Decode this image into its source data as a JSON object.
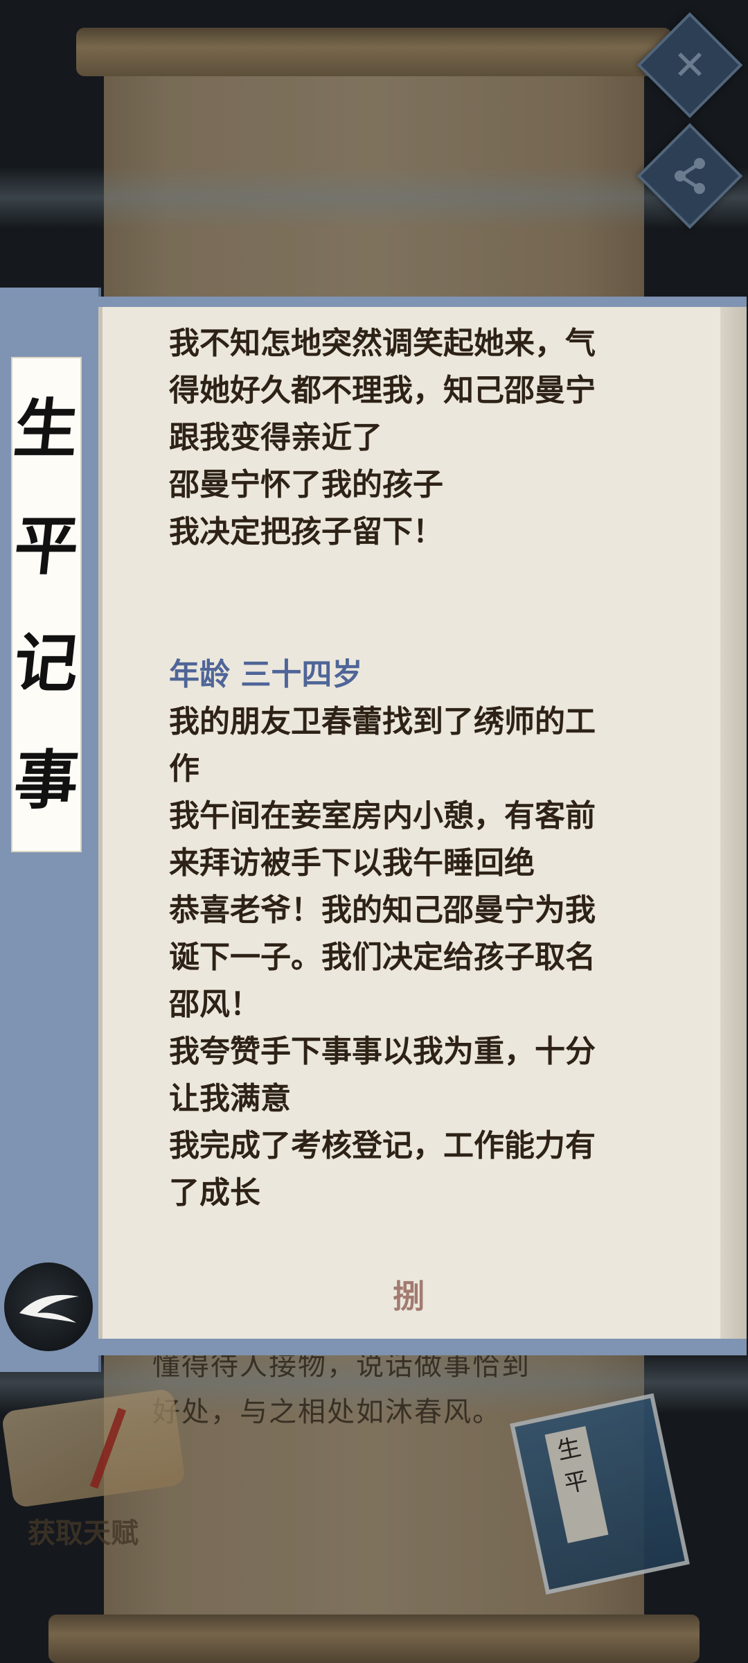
{
  "modal": {
    "title_chars": [
      "生",
      "平",
      "记",
      "事"
    ],
    "lines_before": [
      "我不知怎地突然调笑起她来，气",
      "得她好久都不理我，知己邵曼宁",
      "跟我变得亲近了",
      "邵曼宁怀了我的孩子",
      "我决定把孩子留下！"
    ],
    "age_heading": "年龄 三十四岁",
    "lines_after": [
      "我的朋友卫春蕾找到了绣师的工",
      "作",
      "我午间在妾室房内小憩，有客前",
      "来拜访被手下以我午睡回绝",
      "恭喜老爷！我的知己邵曼宁为我",
      "诞下一子。我们决定给孩子取名",
      "邵风！",
      "我夸赞手下事事以我为重，十分",
      "让我满意",
      "我完成了考核登记，工作能力有",
      "了成长"
    ],
    "end_mark": "捌"
  },
  "background": {
    "desc_line1": "懂得待人接物，说话做事恰到",
    "desc_line2": "好处，与之相处如沐春风。",
    "talent_button": "获取天赋",
    "book_label": "生平"
  },
  "icons": {
    "close": "close-icon",
    "share": "share-icon",
    "back": "back-arrow-icon"
  },
  "colors": {
    "panel_blue": "#7f93b2",
    "paper": "#ebe7dc",
    "age_heading": "#4f6598",
    "text": "#2e2216"
  }
}
